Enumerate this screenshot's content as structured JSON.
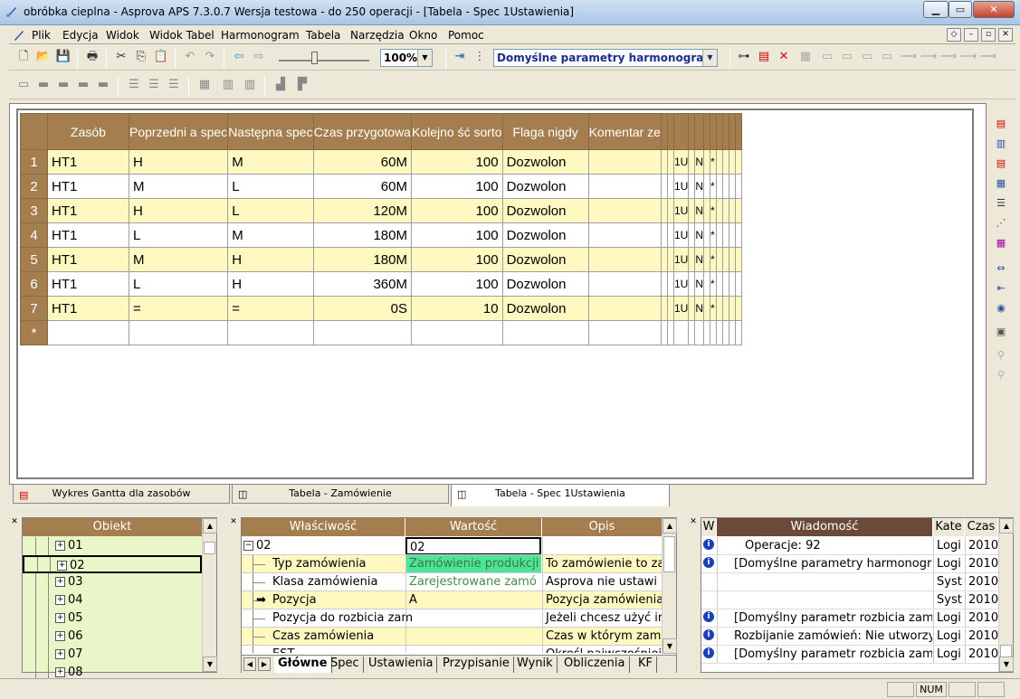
{
  "window": {
    "title": "obróbka cieplna - Asprova APS 7.3.0.7 Wersja testowa  - do 250 operacji - [Tabela - Spec 1Ustawienia]"
  },
  "menu": [
    "Plik",
    "Edycja",
    "Widok",
    "Widok Tabel",
    "Harmonogram",
    "Tabela",
    "Narzędzia",
    "Okno",
    "Pomoc"
  ],
  "toolbar": {
    "zoom": "100%",
    "schedule_param": "Domyślne parametry harmonogramu"
  },
  "grid": {
    "headers": [
      "Zasób",
      "Poprzedni a spec",
      "Następna spec",
      "Czas przygotowa",
      "Kolejno ść sorto",
      "Flaga nigdy",
      "Komentar ze"
    ],
    "rows": [
      {
        "n": "1",
        "c": [
          "HT1",
          "H",
          "M",
          "60M",
          "100",
          "Dozwolon",
          ""
        ],
        "x": "1U",
        "m": "N",
        "s": "*"
      },
      {
        "n": "2",
        "c": [
          "HT1",
          "M",
          "L",
          "60M",
          "100",
          "Dozwolon",
          ""
        ],
        "x": "1U",
        "m": "N",
        "s": "*"
      },
      {
        "n": "3",
        "c": [
          "HT1",
          "H",
          "L",
          "120M",
          "100",
          "Dozwolon",
          ""
        ],
        "x": "1U",
        "m": "N",
        "s": "*"
      },
      {
        "n": "4",
        "c": [
          "HT1",
          "L",
          "M",
          "180M",
          "100",
          "Dozwolon",
          ""
        ],
        "x": "1U",
        "m": "N",
        "s": "*"
      },
      {
        "n": "5",
        "c": [
          "HT1",
          "M",
          "H",
          "180M",
          "100",
          "Dozwolon",
          ""
        ],
        "x": "1U",
        "m": "N",
        "s": "*"
      },
      {
        "n": "6",
        "c": [
          "HT1",
          "L",
          "H",
          "360M",
          "100",
          "Dozwolon",
          ""
        ],
        "x": "1U",
        "m": "N",
        "s": "*"
      },
      {
        "n": "7",
        "c": [
          "HT1",
          "=",
          "=",
          "0S",
          "10",
          "Dozwolon",
          ""
        ],
        "x": "1U",
        "m": "N",
        "s": "*"
      }
    ],
    "new_row": "*"
  },
  "doc_tabs": [
    "Wykres Gantta dla zasobów",
    "Tabela - Zamówienie",
    "Tabela - Spec 1Ustawienia"
  ],
  "object_tree": {
    "header": "Obiekt",
    "items": [
      "01",
      "02",
      "03",
      "04",
      "05",
      "06",
      "07",
      "08"
    ]
  },
  "props": {
    "headers": [
      "Właściwość",
      "Wartość",
      "Opis"
    ],
    "rows": [
      {
        "p": "02",
        "v": "02",
        "d": ""
      },
      {
        "p": "Typ zamówienia",
        "v": "Zamówienie produkcji",
        "d": "To zamówienie to za"
      },
      {
        "p": "Klasa zamówienia",
        "v": "Zarejestrowane zamó",
        "d": "Asprova nie ustawi a"
      },
      {
        "p": "Pozycja",
        "v": "A",
        "d": "Pozycja zamówienia."
      },
      {
        "p": "Pozycja do rozbicia zam",
        "v": "",
        "d": "Jeżeli chcesz użyć inn"
      },
      {
        "p": "Czas zamówienia",
        "v": "",
        "d": "Czas w którym zamó"
      },
      {
        "p": "EST",
        "v": "",
        "d": "Określ najwcześniejsz"
      }
    ],
    "tabs": [
      "Główne",
      "Spec",
      "Ustawienia",
      "Przypisanie",
      "Wynik",
      "Obliczenia",
      "KF"
    ]
  },
  "messages": {
    "headers": [
      "W",
      "Wiadomość",
      "Kate",
      "Czas"
    ],
    "rows": [
      {
        "m": "Operacje: 92",
        "k": "Logi",
        "t": "2010"
      },
      {
        "m": "[Domyślne parametry harmonogram",
        "k": "Logi",
        "t": "2010"
      },
      {
        "m": "",
        "k": "Syst",
        "t": "2010"
      },
      {
        "m": "",
        "k": "Syst",
        "t": "2010"
      },
      {
        "m": "[Domyślny parametr rozbicia zamówi",
        "k": "Logi",
        "t": "2010"
      },
      {
        "m": "Rozbijanie zamówień: Nie utworzyłe",
        "k": "Logi",
        "t": "2010"
      },
      {
        "m": "[Domyślny parametr rozbicia zamówi",
        "k": "Logi",
        "t": "2010"
      }
    ]
  },
  "status": {
    "num": "NUM"
  }
}
